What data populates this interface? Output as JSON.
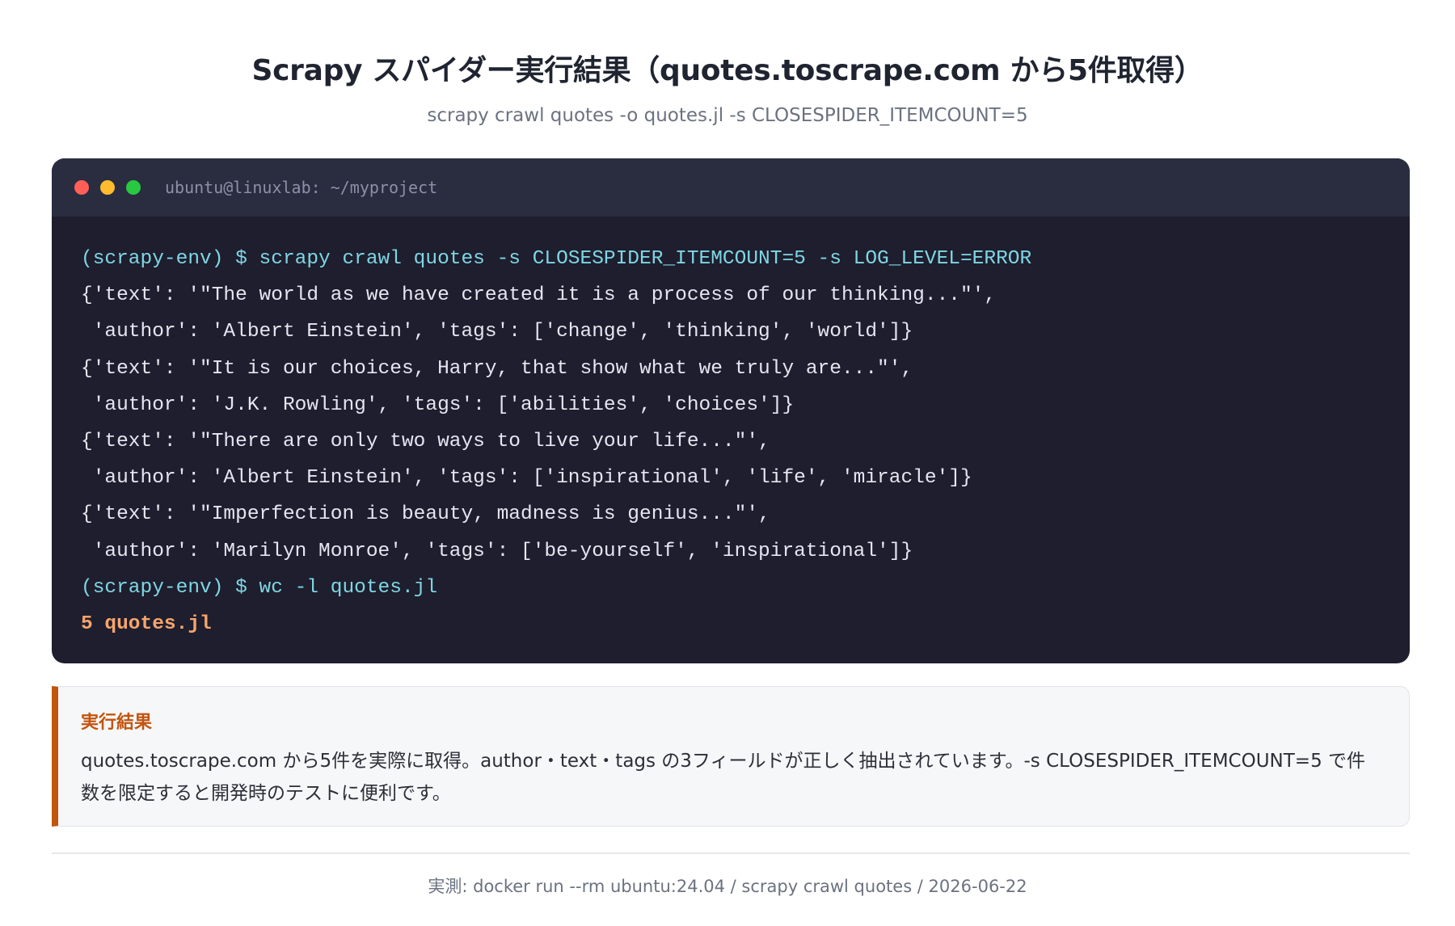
{
  "page": {
    "title": "Scrapy スパイダー実行結果（quotes.toscrape.com から5件取得）",
    "subtitle": "scrapy crawl quotes -o quotes.jl -s CLOSESPIDER_ITEMCOUNT=5"
  },
  "terminal": {
    "title": "ubuntu@linuxlab: ~/myproject",
    "lines": [
      {
        "type": "cmd",
        "text": "(scrapy-env) $ scrapy crawl quotes -s CLOSESPIDER_ITEMCOUNT=5 -s LOG_LEVEL=ERROR"
      },
      {
        "type": "out",
        "text": "{'text': '\"The world as we have created it is a process of our thinking...\"',"
      },
      {
        "type": "out",
        "text": " 'author': 'Albert Einstein', 'tags': ['change', 'thinking', 'world']}"
      },
      {
        "type": "out",
        "text": "{'text': '\"It is our choices, Harry, that show what we truly are...\"',"
      },
      {
        "type": "out",
        "text": " 'author': 'J.K. Rowling', 'tags': ['abilities', 'choices']}"
      },
      {
        "type": "out",
        "text": "{'text': '\"There are only two ways to live your life...\"',"
      },
      {
        "type": "out",
        "text": " 'author': 'Albert Einstein', 'tags': ['inspirational', 'life', 'miracle']}"
      },
      {
        "type": "out",
        "text": "{'text': '\"Imperfection is beauty, madness is genius...\"',"
      },
      {
        "type": "out",
        "text": " 'author': 'Marilyn Monroe', 'tags': ['be-yourself', 'inspirational']}"
      },
      {
        "type": "cmd",
        "text": "(scrapy-env) $ wc -l quotes.jl"
      },
      {
        "type": "res",
        "text": "5 quotes.jl"
      }
    ]
  },
  "result": {
    "label": "実行結果",
    "text": "quotes.toscrape.com から5件を実際に取得。author・text・tags の3フィールドが正しく抽出されています。-s CLOSESPIDER_ITEMCOUNT=5 で件数を限定すると開発時のテストに便利です。"
  },
  "footer": {
    "text": "実測: docker run --rm ubuntu:24.04 / scrapy crawl quotes / 2026-06-22"
  },
  "colors": {
    "terminal_bg": "#1e1e2e",
    "terminal_bar": "#2a2c40",
    "command": "#7fd6e3",
    "output": "#e4e6f0",
    "result": "#f7a56c",
    "accent": "#c2540e"
  }
}
